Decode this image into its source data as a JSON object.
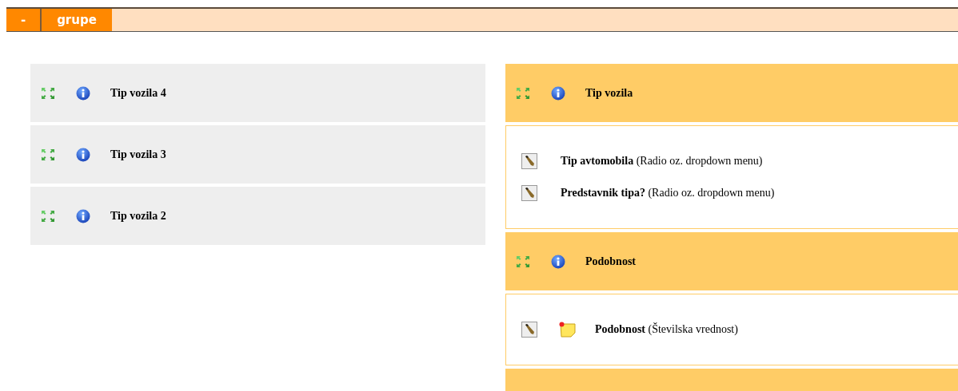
{
  "tabs": [
    {
      "label": "-"
    },
    {
      "label": "grupe"
    }
  ],
  "left_groups": [
    {
      "title": "Tip vozila 4"
    },
    {
      "title": "Tip vozila 3"
    },
    {
      "title": "Tip vozila 2"
    }
  ],
  "right_groups": [
    {
      "title": "Tip vozila",
      "expanded": true,
      "items": [
        {
          "text": "**Tip avtomobila** (Radio oz. dropdown menu)",
          "note": false
        },
        {
          "text": "**Predstavnik tipa?** (Radio oz. dropdown menu)",
          "note": false
        }
      ]
    },
    {
      "title": "Podobnost",
      "expanded": true,
      "items": [
        {
          "text": "**Podobnost** (Številska vrednost)",
          "note": true
        }
      ]
    },
    {
      "expanded": false
    }
  ]
}
